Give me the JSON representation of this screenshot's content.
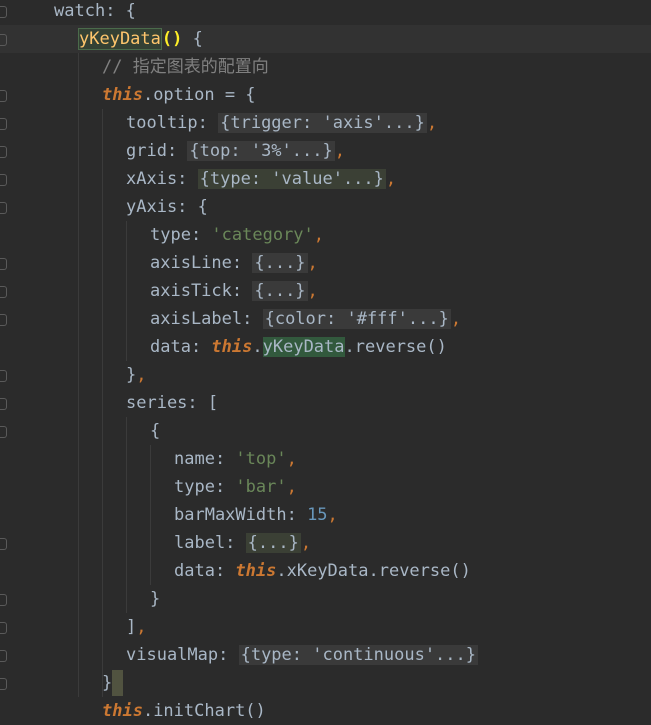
{
  "editor": {
    "lines": [
      {
        "id": "l0",
        "indent": 0,
        "tokens": [
          {
            "c": "prop",
            "t": "watch"
          },
          {
            "c": "prop",
            "t": ": {"
          }
        ]
      },
      {
        "id": "l1",
        "indent": 1,
        "tokens": [
          {
            "c": "fn hl-green",
            "t": "yKeyData"
          },
          {
            "c": "paren-hl",
            "t": "()"
          },
          {
            "c": "prop",
            "t": " {"
          }
        ]
      },
      {
        "id": "l2",
        "indent": 2,
        "tokens": [
          {
            "c": "cmt",
            "t": "// 指定图表的配置向"
          }
        ]
      },
      {
        "id": "l3",
        "indent": 2,
        "tokens": [
          {
            "c": "kw",
            "t": "this"
          },
          {
            "c": "prop",
            "t": ".option = {"
          }
        ]
      },
      {
        "id": "l4",
        "indent": 3,
        "tokens": [
          {
            "c": "prop",
            "t": "tooltip: "
          },
          {
            "c": "fold-box",
            "t": "{trigger: 'axis'...}"
          },
          {
            "c": "kwp",
            "t": ","
          }
        ]
      },
      {
        "id": "l5",
        "indent": 3,
        "tokens": [
          {
            "c": "prop",
            "t": "grid: "
          },
          {
            "c": "fold-box",
            "t": "{top: '3%'...}"
          },
          {
            "c": "kwp",
            "t": ","
          }
        ]
      },
      {
        "id": "l6",
        "indent": 3,
        "tokens": [
          {
            "c": "prop",
            "t": "xAxis: "
          },
          {
            "c": "fold-box-hl",
            "t": "{type: 'value'...}"
          },
          {
            "c": "kwp",
            "t": ","
          }
        ]
      },
      {
        "id": "l7",
        "indent": 3,
        "tokens": [
          {
            "c": "prop",
            "t": "yAxis: {"
          }
        ]
      },
      {
        "id": "l8",
        "indent": 4,
        "tokens": [
          {
            "c": "prop",
            "t": "type: "
          },
          {
            "c": "str",
            "t": "'category'"
          },
          {
            "c": "kwp",
            "t": ","
          }
        ]
      },
      {
        "id": "l9",
        "indent": 4,
        "tokens": [
          {
            "c": "prop",
            "t": "axisLine: "
          },
          {
            "c": "fold-box",
            "t": "{...}"
          },
          {
            "c": "kwp",
            "t": ","
          }
        ]
      },
      {
        "id": "l10",
        "indent": 4,
        "tokens": [
          {
            "c": "prop",
            "t": "axisTick: "
          },
          {
            "c": "fold-box",
            "t": "{...}"
          },
          {
            "c": "kwp",
            "t": ","
          }
        ]
      },
      {
        "id": "l11",
        "indent": 4,
        "tokens": [
          {
            "c": "prop",
            "t": "axisLabel: "
          },
          {
            "c": "fold-box",
            "t": "{color: '#fff'...}"
          },
          {
            "c": "kwp",
            "t": ","
          }
        ]
      },
      {
        "id": "l12",
        "indent": 4,
        "tokens": [
          {
            "c": "prop",
            "t": "data: "
          },
          {
            "c": "kw",
            "t": "this"
          },
          {
            "c": "prop",
            "t": "."
          },
          {
            "c": "prop hl-green-strong",
            "t": "yKeyData"
          },
          {
            "c": "prop",
            "t": ".reverse()"
          }
        ]
      },
      {
        "id": "l13",
        "indent": 3,
        "tokens": [
          {
            "c": "prop",
            "t": "}"
          },
          {
            "c": "kwp",
            "t": ","
          }
        ]
      },
      {
        "id": "l14",
        "indent": 3,
        "tokens": [
          {
            "c": "prop",
            "t": "series: ["
          }
        ]
      },
      {
        "id": "l15",
        "indent": 4,
        "tokens": [
          {
            "c": "prop",
            "t": "{"
          }
        ]
      },
      {
        "id": "l16",
        "indent": 5,
        "tokens": [
          {
            "c": "prop",
            "t": "name: "
          },
          {
            "c": "str",
            "t": "'top'"
          },
          {
            "c": "kwp",
            "t": ","
          }
        ]
      },
      {
        "id": "l17",
        "indent": 5,
        "tokens": [
          {
            "c": "prop",
            "t": "type: "
          },
          {
            "c": "str",
            "t": "'bar'"
          },
          {
            "c": "kwp",
            "t": ","
          }
        ]
      },
      {
        "id": "l18",
        "indent": 5,
        "tokens": [
          {
            "c": "prop",
            "t": "barMaxWidth: "
          },
          {
            "c": "num",
            "t": "15"
          },
          {
            "c": "kwp",
            "t": ","
          }
        ]
      },
      {
        "id": "l19",
        "indent": 5,
        "tokens": [
          {
            "c": "prop",
            "t": "label: "
          },
          {
            "c": "fold-box-hl",
            "t": "{...}"
          },
          {
            "c": "kwp",
            "t": ","
          }
        ]
      },
      {
        "id": "l20",
        "indent": 5,
        "tokens": [
          {
            "c": "prop",
            "t": "data: "
          },
          {
            "c": "kw",
            "t": "this"
          },
          {
            "c": "prop",
            "t": ".xKeyData.reverse()"
          }
        ]
      },
      {
        "id": "l21",
        "indent": 4,
        "tokens": [
          {
            "c": "prop",
            "t": "}"
          }
        ]
      },
      {
        "id": "l22",
        "indent": 3,
        "tokens": [
          {
            "c": "prop",
            "t": "]"
          },
          {
            "c": "kwp",
            "t": ","
          }
        ]
      },
      {
        "id": "l23",
        "indent": 3,
        "tokens": [
          {
            "c": "prop",
            "t": "visualMap: "
          },
          {
            "c": "fold-box",
            "t": "{type: 'continuous'...}"
          }
        ]
      },
      {
        "id": "l24",
        "indent": 2,
        "tokens": [
          {
            "c": "prop",
            "t": "}"
          },
          {
            "c": "cursor",
            "t": ""
          }
        ]
      },
      {
        "id": "l25",
        "indent": 2,
        "tokens": [
          {
            "c": "kw",
            "t": "this"
          },
          {
            "c": "prop",
            "t": ".initChart()"
          }
        ]
      }
    ]
  },
  "colors": {
    "background": "#2b2b2b",
    "keyword": "#cc7832",
    "string": "#6a8759",
    "number": "#6897bb",
    "comment": "#808080",
    "function": "#ffc66d",
    "text": "#a9b7c6"
  },
  "icons": {
    "intention": "lightbulb-icon",
    "fold": "fold-marker-icon"
  }
}
